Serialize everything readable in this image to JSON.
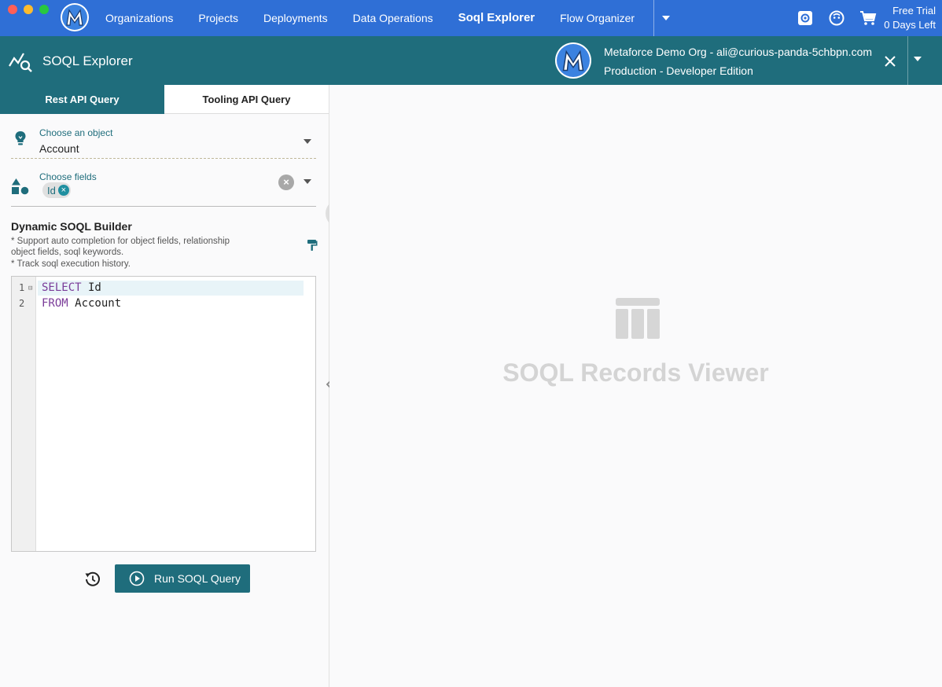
{
  "window": {
    "traffic_lights": [
      "close",
      "minimize",
      "maximize"
    ]
  },
  "topbar": {
    "nav": [
      {
        "label": "Organizations"
      },
      {
        "label": "Projects"
      },
      {
        "label": "Deployments"
      },
      {
        "label": "Data Operations"
      },
      {
        "label": "Soql Explorer",
        "active": true
      },
      {
        "label": "Flow Organizer"
      }
    ],
    "trial_line1": "Free Trial",
    "trial_line2": "0 Days Left",
    "icons": [
      "settings-icon",
      "account-icon",
      "cart-icon"
    ],
    "color": "#2f6fd6"
  },
  "subheader": {
    "title": "SOQL Explorer",
    "org_line1": "Metaforce Demo Org - ali@curious-panda-5chbpn.com",
    "org_line2": "Production - Developer Edition",
    "color": "#1f6d7c"
  },
  "tabs": {
    "rest": "Rest API Query",
    "tooling": "Tooling API Query",
    "active": "rest"
  },
  "object_field": {
    "label": "Choose an object",
    "value": "Account"
  },
  "fields_field": {
    "label": "Choose fields",
    "chips": [
      "Id"
    ]
  },
  "builder": {
    "title": "Dynamic SOQL Builder",
    "notes": [
      "* Support auto completion for object fields, relationship",
      "object fields, soql keywords.",
      "* Track soql execution history."
    ]
  },
  "editor": {
    "lines": [
      {
        "num": "1",
        "keyword": "SELECT",
        "rest": " Id"
      },
      {
        "num": "2",
        "keyword": "FROM",
        "rest": " Account"
      }
    ]
  },
  "run_button": {
    "label": "Run SOQL Query"
  },
  "viewer": {
    "title": "SOQL Records Viewer"
  }
}
